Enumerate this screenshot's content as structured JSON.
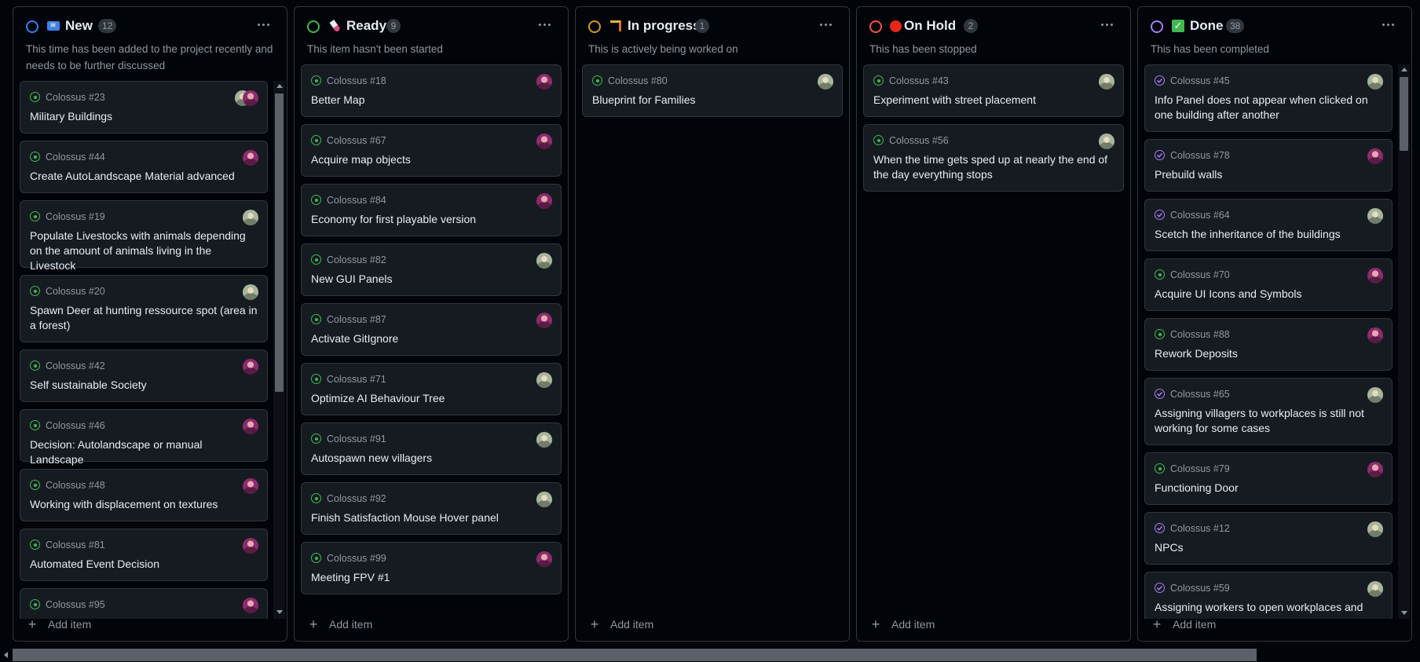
{
  "columns": [
    {
      "title": "New",
      "emoji": "🆕",
      "count": "12",
      "circle_color": "#2f81f7",
      "description": "This time has been added to the project recently and needs to be further discussed",
      "add_label": "Add item",
      "cards": [
        {
          "id": "Colossus #23",
          "title": "Military Buildings",
          "avatar": "duo",
          "state": "open"
        },
        {
          "id": "Colossus #44",
          "title": "Create AutoLandscape Material advanced",
          "avatar": "pink",
          "state": "open"
        },
        {
          "id": "Colossus #19",
          "title": "Populate Livestocks with animals depending on the amount of animals living in the Livestock",
          "avatar": "green",
          "state": "open"
        },
        {
          "id": "Colossus #20",
          "title": "Spawn Deer at hunting ressource spot (area in a forest)",
          "avatar": "green",
          "state": "open"
        },
        {
          "id": "Colossus #42",
          "title": "Self sustainable Society",
          "avatar": "pink",
          "state": "open"
        },
        {
          "id": "Colossus #46",
          "title": "Decision: Autolandscape or manual Landscape",
          "avatar": "pink",
          "state": "open"
        },
        {
          "id": "Colossus #48",
          "title": "Working with displacement on textures",
          "avatar": "pink",
          "state": "open"
        },
        {
          "id": "Colossus #81",
          "title": "Automated Event Decision",
          "avatar": "pink",
          "state": "open"
        },
        {
          "id": "Colossus #95",
          "title": "",
          "avatar": "pink",
          "state": "open"
        }
      ]
    },
    {
      "title": "Ready",
      "emoji": "🧪",
      "count": "9",
      "circle_color": "#3fb950",
      "description": "This item hasn't been started",
      "add_label": "Add item",
      "cards": [
        {
          "id": "Colossus #18",
          "title": "Better Map",
          "avatar": "pink",
          "state": "open"
        },
        {
          "id": "Colossus #67",
          "title": "Acquire map objects",
          "avatar": "pink",
          "state": "open"
        },
        {
          "id": "Colossus #84",
          "title": "Economy for first playable version",
          "avatar": "pink",
          "state": "open"
        },
        {
          "id": "Colossus #82",
          "title": "New GUI Panels",
          "avatar": "green",
          "state": "open"
        },
        {
          "id": "Colossus #87",
          "title": "Activate GitIgnore",
          "avatar": "pink",
          "state": "open"
        },
        {
          "id": "Colossus #71",
          "title": "Optimize AI Behaviour Tree",
          "avatar": "green",
          "state": "open"
        },
        {
          "id": "Colossus #91",
          "title": "Autospawn new villagers",
          "avatar": "green",
          "state": "open"
        },
        {
          "id": "Colossus #92",
          "title": "Finish Satisfaction Mouse Hover panel",
          "avatar": "green",
          "state": "open"
        },
        {
          "id": "Colossus #99",
          "title": "Meeting FPV #1",
          "avatar": "pink",
          "state": "open"
        }
      ]
    },
    {
      "title": "In progress",
      "emoji": "🏗",
      "count": "1",
      "circle_color": "#d29922",
      "description": "This is actively being worked on",
      "add_label": "Add item",
      "cards": [
        {
          "id": "Colossus #80",
          "title": "Blueprint for Families",
          "avatar": "green",
          "state": "open"
        }
      ]
    },
    {
      "title": "On Hold",
      "emoji": "🔴",
      "count": "2",
      "circle_color": "#f85149",
      "description": "This has been stopped",
      "add_label": "Add item",
      "cards": [
        {
          "id": "Colossus #43",
          "title": "Experiment with street placement",
          "avatar": "green",
          "state": "open"
        },
        {
          "id": "Colossus #56",
          "title": "When the time gets sped up at nearly the end of the day everything stops",
          "avatar": "green",
          "state": "open"
        }
      ]
    },
    {
      "title": "Done",
      "emoji": "✅",
      "count": "38",
      "circle_color": "#ab7df8",
      "description": "This has been completed",
      "add_label": "Add item",
      "cards": [
        {
          "id": "Colossus #45",
          "title": "Info Panel does not appear when clicked on one building after another",
          "avatar": "green",
          "state": "done"
        },
        {
          "id": "Colossus #78",
          "title": "Prebuild walls",
          "avatar": "pink",
          "state": "done"
        },
        {
          "id": "Colossus #64",
          "title": "Scetch the inheritance of the buildings",
          "avatar": "green",
          "state": "done"
        },
        {
          "id": "Colossus #70",
          "title": "Acquire UI Icons and Symbols",
          "avatar": "pink",
          "state": "open"
        },
        {
          "id": "Colossus #88",
          "title": "Rework Deposits",
          "avatar": "pink",
          "state": "open"
        },
        {
          "id": "Colossus #65",
          "title": "Assigning villagers to workplaces is still not working for some cases",
          "avatar": "green",
          "state": "done"
        },
        {
          "id": "Colossus #79",
          "title": "Functioning Door",
          "avatar": "pink",
          "state": "open"
        },
        {
          "id": "Colossus #12",
          "title": "NPCs",
          "avatar": "green",
          "state": "done"
        },
        {
          "id": "Colossus #59",
          "title": "Assigning workers to open workplaces and",
          "avatar": "green",
          "state": "done"
        }
      ]
    }
  ]
}
